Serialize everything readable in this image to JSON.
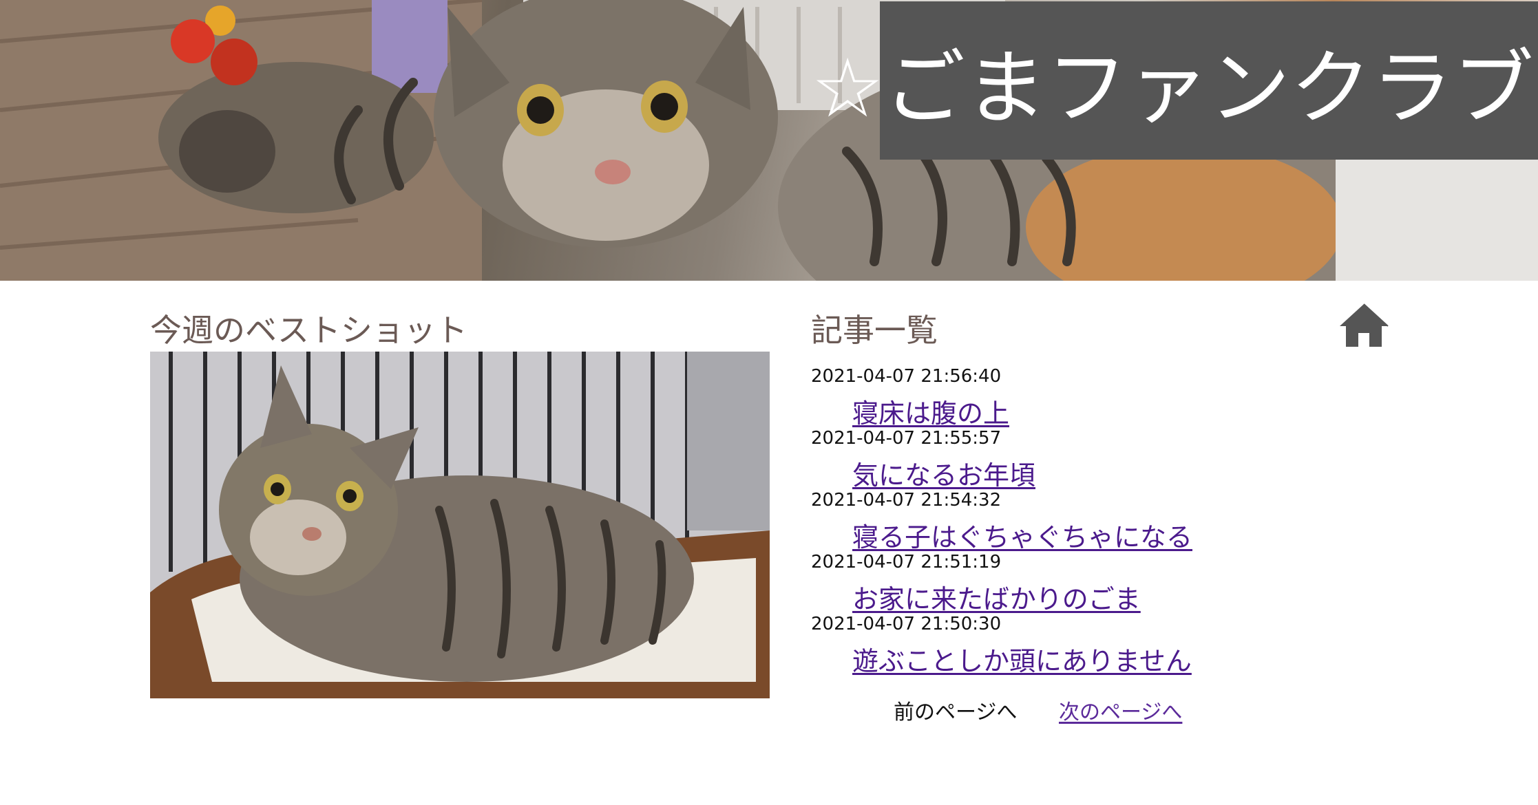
{
  "header": {
    "title": "☆ごまファンクラブ☆",
    "banner_image": "tabby-cat-playing-photo"
  },
  "best_shot": {
    "heading": "今週のベストショット",
    "image": "tabby-cat-in-bed-photo"
  },
  "articles": {
    "heading": "記事一覧",
    "items": [
      {
        "date": "2021-04-07 21:56:40",
        "title": "寝床は腹の上"
      },
      {
        "date": "2021-04-07 21:55:57",
        "title": "気になるお年頃"
      },
      {
        "date": "2021-04-07 21:54:32",
        "title": "寝る子はぐちゃぐちゃになる"
      },
      {
        "date": "2021-04-07 21:51:19",
        "title": "お家に来たばかりのごま"
      },
      {
        "date": "2021-04-07 21:50:30",
        "title": "遊ぶことしか頭にありません"
      }
    ]
  },
  "pagination": {
    "prev_label": "前のページへ",
    "next_label": "次のページへ"
  },
  "nav": {
    "home_icon": "home-icon"
  },
  "colors": {
    "title_box": "#555555",
    "heading_text": "#6b5a55",
    "link": "#4b1a8c",
    "home_icon": "#555555"
  }
}
